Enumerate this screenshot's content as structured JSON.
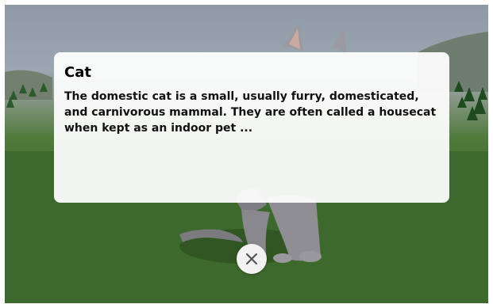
{
  "info_card": {
    "title": "Cat",
    "description": "The domestic cat is a small, usually furry, domesticated, and carnivorous mammal. They are often called a housecat when kept as an indoor pet ..."
  },
  "close_button": {
    "icon": "close-icon"
  },
  "colors": {
    "sky": "#9ba6b0",
    "ground": "#3f6a2d",
    "card_background": "#ffffff",
    "cat_fur": "#8a8a8c"
  }
}
